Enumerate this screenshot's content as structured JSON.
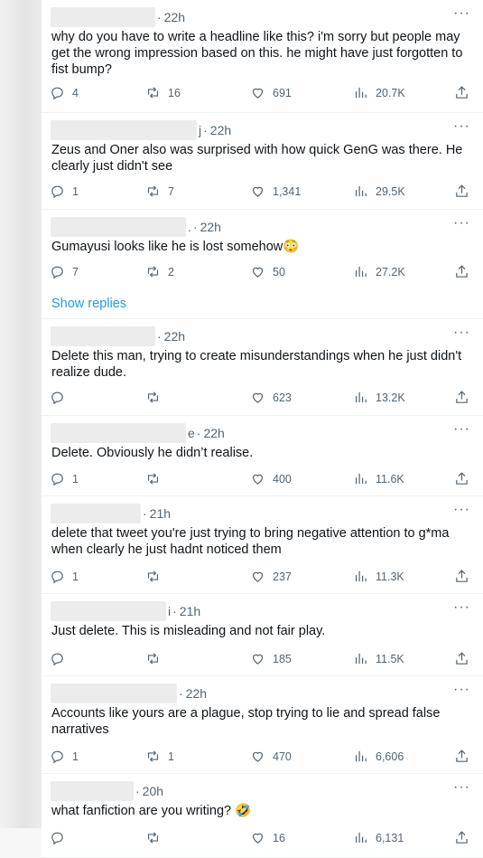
{
  "tweets": [
    {
      "handle_tail": "",
      "time": "22h",
      "text": "why do you have to write a headline like this? i'm sorry but people may get the wrong impression based on this. he might have just forgotten to fist bump?",
      "replies": "4",
      "reposts": "16",
      "likes": "691",
      "views": "20.7K"
    },
    {
      "handle_tail": "j",
      "time": "22h",
      "text": "Zeus and Oner also was surprised with how quick GenG was there. He clearly just didn't see",
      "replies": "1",
      "reposts": "7",
      "likes": "1,341",
      "views": "29.5K"
    },
    {
      "handle_tail": ".",
      "time": "22h",
      "text": "Gumayusi looks like he is lost somehow😳",
      "replies": "7",
      "reposts": "2",
      "likes": "50",
      "views": "27.2K"
    },
    {
      "handle_tail": "",
      "time": "22h",
      "text": "Delete this man, trying to create misunderstandings when he just didn't realize dude.",
      "replies": "",
      "reposts": "",
      "likes": "623",
      "views": "13.2K"
    },
    {
      "handle_tail": "e",
      "time": "22h",
      "text": "Delete. Obviously he didn’t realise.",
      "replies": "1",
      "reposts": "",
      "likes": "400",
      "views": "11.6K"
    },
    {
      "handle_tail": "",
      "time": "21h",
      "text": "delete that tweet you're just trying to bring negative attention to g*ma when clearly he just hadnt noticed them",
      "replies": "1",
      "reposts": "",
      "likes": "237",
      "views": "11.3K"
    },
    {
      "handle_tail": "i",
      "time": "21h",
      "text": "Just delete. This is misleading and not fair play.",
      "replies": "",
      "reposts": "",
      "likes": "185",
      "views": "11.5K"
    },
    {
      "handle_tail": "",
      "time": "22h",
      "text": "Accounts like yours are a plague, stop trying to lie and spread false narratives",
      "replies": "1",
      "reposts": "1",
      "likes": "470",
      "views": "6,606"
    },
    {
      "handle_tail": "",
      "time": "20h",
      "text": "what fanfiction are you writing? 🤣",
      "replies": "",
      "reposts": "",
      "likes": "16",
      "views": "6,131"
    }
  ],
  "show_replies_label": "Show replies",
  "more_glyph": "···"
}
